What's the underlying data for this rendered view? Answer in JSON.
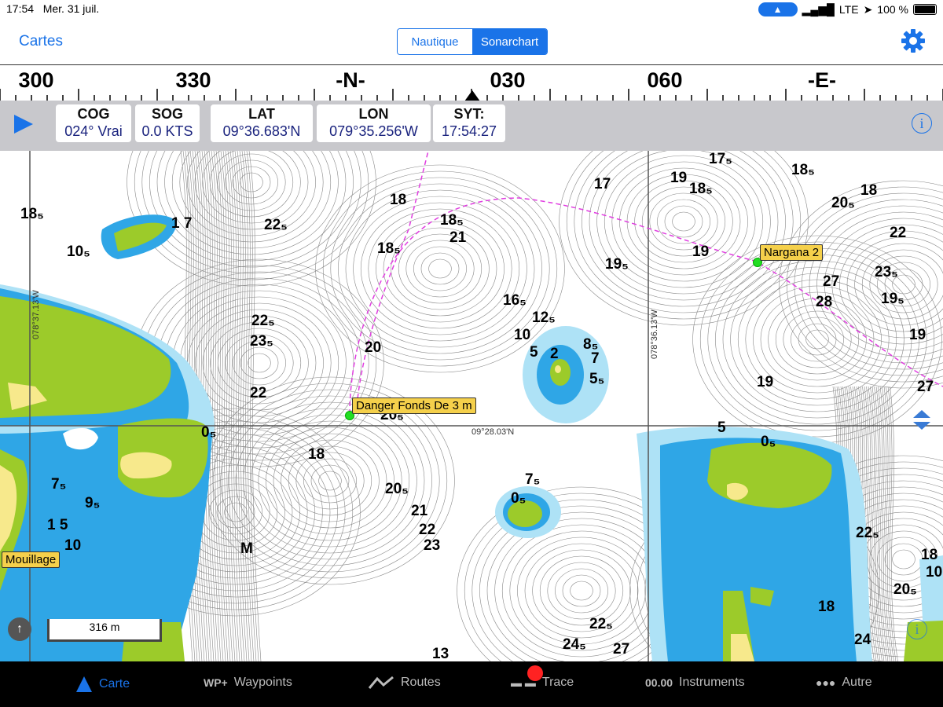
{
  "status_bar": {
    "time": "17:54",
    "date": "Mer. 31 juil.",
    "network": "LTE",
    "battery": "100 %"
  },
  "nav": {
    "back_label": "Cartes",
    "seg_left": "Nautique",
    "seg_right": "Sonarchart",
    "selected": "Sonarchart"
  },
  "compass": {
    "labels": [
      "300",
      "330",
      "-N-",
      "030",
      "060",
      "-E-"
    ]
  },
  "info": {
    "cog": {
      "label": "COG",
      "value": "024° Vrai"
    },
    "sog": {
      "label": "SOG",
      "value": "0.0 KTS"
    },
    "lat": {
      "label": "LAT",
      "value": "09°36.683'N"
    },
    "lon": {
      "label": "LON",
      "value": "079°35.256'W"
    },
    "syt": {
      "label": "SYT:",
      "value": "17:54:27"
    }
  },
  "map": {
    "coords": {
      "lon1": "078°37.13'W",
      "lon2": "078°36.13'W",
      "lat1": "09°28.03'N"
    },
    "scale": "316 m",
    "waypoints": [
      "Danger Fonds De 3 m",
      "Nargana 2",
      "Mouillage"
    ],
    "depths": [
      "18₅",
      "1 7",
      "22₅",
      "10₅",
      "18",
      "18₅",
      "21",
      "18₅",
      "17",
      "19",
      "17₅",
      "18₅",
      "18₅",
      "20₅",
      "18",
      "22",
      "19₅",
      "19",
      "27",
      "28",
      "23₅",
      "19₅",
      "22₅",
      "23₅",
      "20",
      "16₅",
      "12₅",
      "10",
      "5",
      "2",
      "8₅",
      "7",
      "5₅",
      "19",
      "22",
      "19",
      "27",
      "20₅",
      "0₅",
      "5",
      "0₅",
      "18",
      "7₅",
      "9₅",
      "1 5",
      "10",
      "20₅",
      "21",
      "22",
      "23",
      "7₅",
      "0₅",
      "M",
      "22₅",
      "18",
      "20₅",
      "24",
      "18",
      "24₅",
      "22₅",
      "27",
      "13",
      "10"
    ],
    "colors": {
      "green": "#9ccb2a",
      "blue": "#2fa6e6",
      "lightblue": "#aee2f6",
      "yellow": "#f7e98c",
      "route": "#e03ee0"
    }
  },
  "tabs": {
    "carte": "Carte",
    "waypoints_icon": "WP+",
    "waypoints": "Waypoints",
    "routes": "Routes",
    "trace": "Trace",
    "instruments_icon": "00.00",
    "instruments": "Instruments",
    "autre": "Autre"
  }
}
